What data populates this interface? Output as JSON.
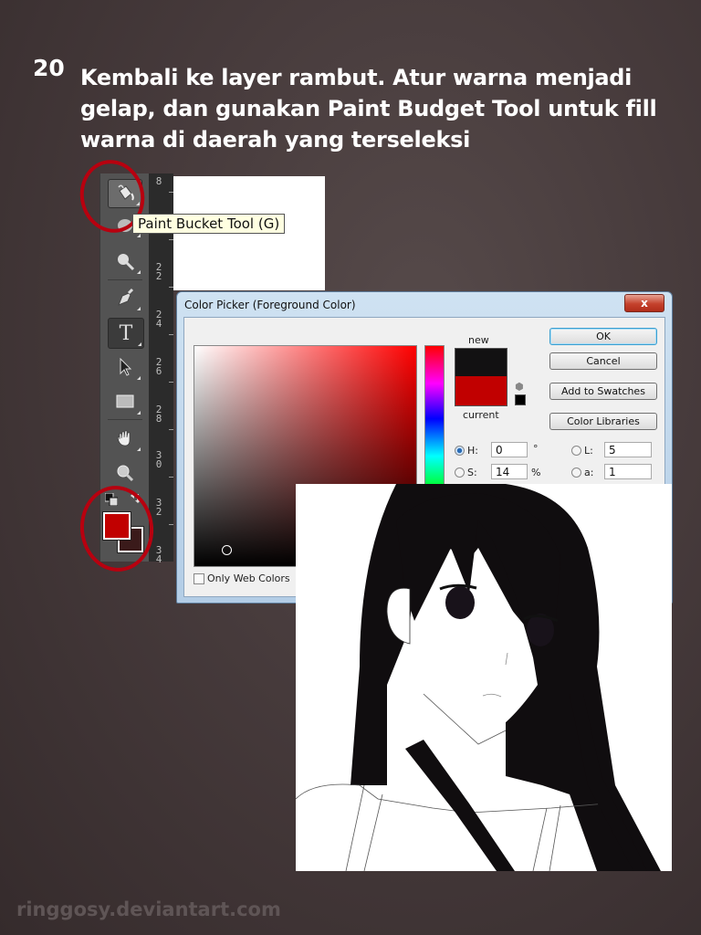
{
  "step": {
    "number": "20",
    "instruction": "Kembali ke layer rambut. Atur warna menjadi gelap, dan gunakan Paint Budget Tool untuk fill warna di daerah yang terseleksi"
  },
  "toolbar": {
    "tools": [
      {
        "name": "paint-bucket",
        "icon": "paint-bucket-icon",
        "active": true
      },
      {
        "name": "blur",
        "icon": "blur-drop-icon"
      },
      {
        "name": "dodge",
        "icon": "dodge-icon"
      },
      {
        "name": "pen",
        "icon": "pen-icon"
      },
      {
        "name": "type",
        "icon": "type-icon",
        "glyph": "T"
      },
      {
        "name": "path-selection",
        "icon": "arrow-cursor-icon"
      },
      {
        "name": "rectangle",
        "icon": "rectangle-icon"
      },
      {
        "name": "hand",
        "icon": "hand-icon"
      },
      {
        "name": "zoom",
        "icon": "zoom-icon"
      }
    ],
    "tooltip": "Paint Bucket Tool (G)",
    "foreground_color": "#c10000",
    "background_color": "#3a1a1a"
  },
  "ruler": {
    "labels": [
      "8",
      "2 2",
      "2 4",
      "2 6",
      "2 8",
      "3 0",
      "3 2",
      "3 4"
    ]
  },
  "color_picker": {
    "title": "Color Picker (Foreground Color)",
    "close_label": "x",
    "new_label": "new",
    "current_label": "current",
    "new_color": "#121112",
    "current_color": "#c10000",
    "buttons": {
      "ok": "OK",
      "cancel": "Cancel",
      "add_to_swatches": "Add to Swatches",
      "color_libraries": "Color Libraries"
    },
    "fields": {
      "H": {
        "label": "H:",
        "value": "0",
        "unit": "°"
      },
      "S": {
        "label": "S:",
        "value": "14",
        "unit": "%"
      },
      "L": {
        "label": "L:",
        "value": "5"
      },
      "a": {
        "label": "a:",
        "value": "1"
      }
    },
    "only_web_colors": "Only Web Colors"
  },
  "watermark": "ringgosy.deviantart.com",
  "accent_colors": {
    "highlight_circle": "#b8000f"
  }
}
